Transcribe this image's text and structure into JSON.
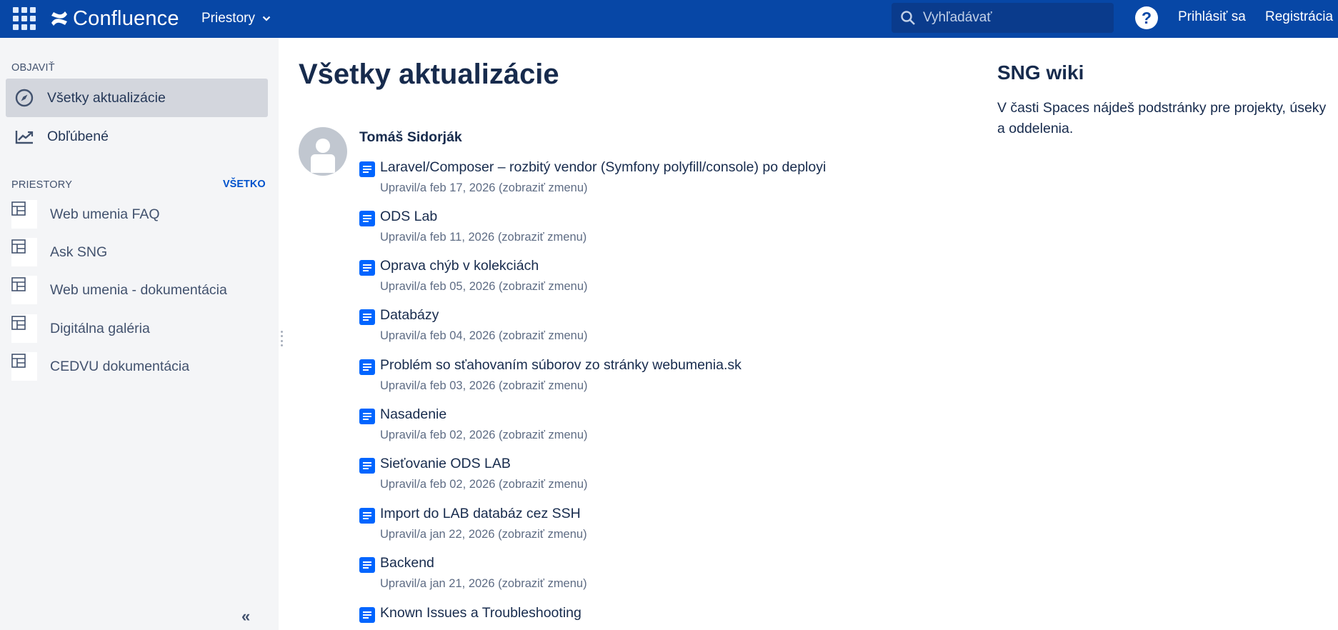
{
  "header": {
    "app_name": "Confluence",
    "spaces_menu": "Priestory",
    "search_placeholder": "Vyhľadávať",
    "help": "?",
    "login": "Prihlásiť sa",
    "register": "Registrácia",
    "bg_color": "#0747a6"
  },
  "sidebar": {
    "discover_label": "OBJAVIŤ",
    "nav": [
      {
        "label": "Všetky aktualizácie",
        "icon": "compass-icon",
        "active": true
      },
      {
        "label": "Obľúbené",
        "icon": "trending-icon",
        "active": false
      }
    ],
    "spaces_label": "PRIESTORY",
    "see_all": "VŠETKO",
    "spaces": [
      {
        "label": "Web umenia FAQ"
      },
      {
        "label": "Ask SNG"
      },
      {
        "label": "Web umenia - dokumentácia"
      },
      {
        "label": "Digitálna galéria"
      },
      {
        "label": "CEDVU dokumentácia"
      }
    ],
    "collapse": "«"
  },
  "main": {
    "title": "Všetky aktualizácie",
    "author": "Tomáš Sidorják",
    "updates": [
      {
        "title": "Laravel/Composer – rozbitý vendor (Symfony polyfill/console) po deployi",
        "meta": "Upravil/a feb 17, 2026 ",
        "change": "(zobraziť zmenu)"
      },
      {
        "title": "ODS Lab",
        "meta": "Upravil/a feb 11, 2026 ",
        "change": "(zobraziť zmenu)"
      },
      {
        "title": "Oprava chýb v kolekciách",
        "meta": "Upravil/a feb 05, 2026 ",
        "change": "(zobraziť zmenu)"
      },
      {
        "title": "Databázy",
        "meta": "Upravil/a feb 04, 2026 ",
        "change": "(zobraziť zmenu)"
      },
      {
        "title": "Problém so sťahovaním súborov zo stránky webumenia.sk",
        "meta": "Upravil/a feb 03, 2026 ",
        "change": "(zobraziť zmenu)"
      },
      {
        "title": "Nasadenie",
        "meta": "Upravil/a feb 02, 2026 ",
        "change": "(zobraziť zmenu)"
      },
      {
        "title": "Sieťovanie ODS LAB",
        "meta": "Upravil/a feb 02, 2026 ",
        "change": "(zobraziť zmenu)"
      },
      {
        "title": "Import do LAB databáz cez SSH",
        "meta": "Upravil/a jan 22, 2026 ",
        "change": "(zobraziť zmenu)"
      },
      {
        "title": "Backend",
        "meta": "Upravil/a jan 21, 2026 ",
        "change": "(zobraziť zmenu)"
      },
      {
        "title": "Known Issues a Troubleshooting",
        "meta": "",
        "change": ""
      }
    ]
  },
  "right_panel": {
    "title": "SNG wiki",
    "description": "V časti Spaces nájdeš podstránky pre projekty, úseky a oddelenia."
  }
}
